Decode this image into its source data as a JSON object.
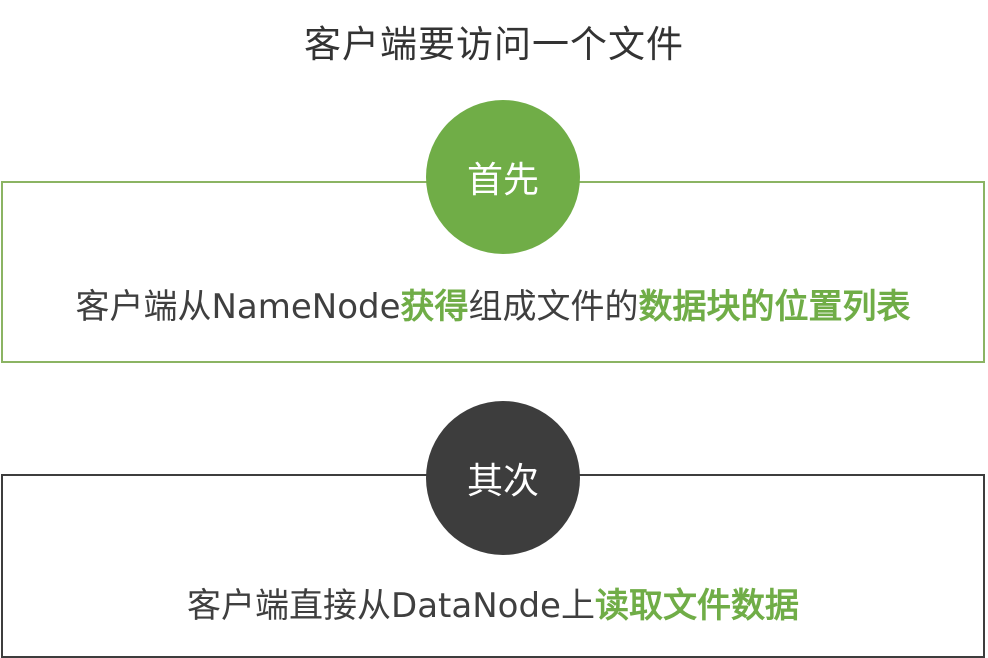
{
  "title": "客户端要访问一个文件",
  "step1": {
    "badge": "首先",
    "text_a": "客户端从NameNode",
    "hl_a": "获得",
    "text_b": "组成文件的",
    "hl_b": "数据块的位置列表"
  },
  "step2": {
    "badge": "其次",
    "text_a": "客户端直接从DataNode上",
    "hl_a": "读取文件数据"
  },
  "colors": {
    "accent_green": "#70ad47",
    "dark_gray": "#3d3d3d",
    "border_green": "#8bb463"
  }
}
